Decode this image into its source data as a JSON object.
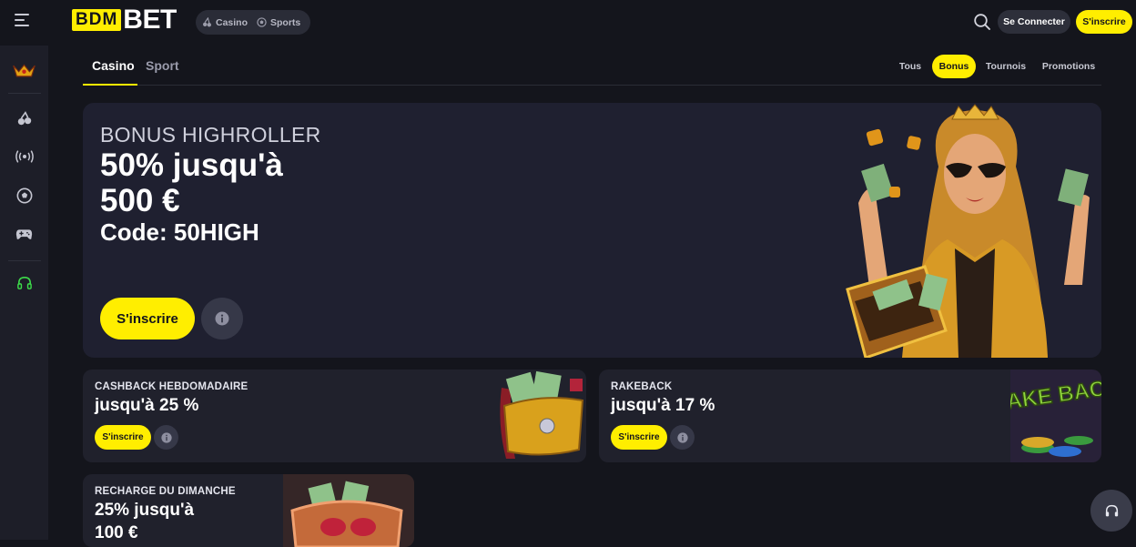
{
  "header": {
    "logo_left": "BDM",
    "logo_right": "BET",
    "modes": [
      {
        "label": "Casino",
        "icon": "cherries-icon"
      },
      {
        "label": "Sports",
        "icon": "football-icon"
      }
    ],
    "login_label": "Se Connecter",
    "register_label": "S'inscrire"
  },
  "tabs": {
    "main": [
      "Casino",
      "Sport"
    ],
    "filters": [
      "Tous",
      "Bonus",
      "Tournois",
      "Promotions"
    ],
    "active_filter": "Bonus"
  },
  "hero": {
    "label": "BONUS HIGHROLLER",
    "line1": "50% jusqu'à",
    "line2": "500 €",
    "code": "Code: 50HIGH",
    "cta": "S'inscrire"
  },
  "cards": [
    {
      "title": "CASHBACK HEBDOMADAIRE",
      "line1": "jusqu'à 25 %",
      "cta": "S'inscrire"
    },
    {
      "title": "RAKEBACK",
      "line1": "jusqu'à 17 %",
      "cta": "S'inscrire",
      "art_text": "RAKE BACK"
    },
    {
      "title": "RECHARGE DU DIMANCHE",
      "line1": "25% jusqu'à",
      "line2": "100 €"
    }
  ],
  "colors": {
    "accent": "#ffee00",
    "background": "#14151c",
    "sidebar": "#1d1e28",
    "card": "#20212c",
    "support_green": "#3ddc4a"
  }
}
